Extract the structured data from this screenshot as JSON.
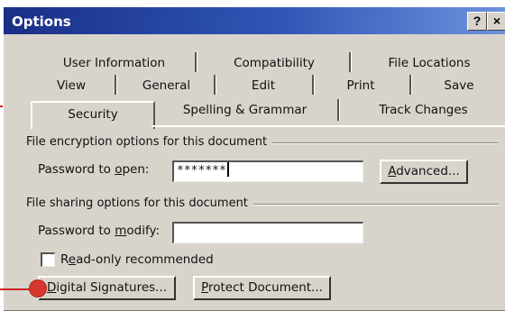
{
  "window": {
    "title": "Options",
    "help_label": "?",
    "close_label": "×"
  },
  "tabs": {
    "row1": [
      "User Information",
      "Compatibility",
      "File Locations"
    ],
    "row2": [
      "View",
      "General",
      "Edit",
      "Print",
      "Save"
    ],
    "row3": [
      "Security",
      "Spelling & Grammar",
      "Track Changes"
    ],
    "active": "Security"
  },
  "encryption": {
    "group_label": "File encryption options for this document",
    "password_label_pre": "Password to ",
    "password_label_key": "o",
    "password_label_post": "pen:",
    "password_value": "*******",
    "advanced_pre": "",
    "advanced_key": "A",
    "advanced_post": "dvanced..."
  },
  "sharing": {
    "group_label": "File sharing options for this document",
    "modify_label_pre": "Password to ",
    "modify_label_key": "m",
    "modify_label_post": "odify:",
    "modify_value": "",
    "readonly_label_pre": "R",
    "readonly_label_key": "e",
    "readonly_label_post": "ad-only recommended",
    "readonly_checked": false
  },
  "buttons": {
    "digital_pre": "",
    "digital_key": "D",
    "digital_post": "igital Signatures...",
    "protect_pre": "",
    "protect_key": "P",
    "protect_post": "rotect Document..."
  },
  "colors": {
    "callout": "#d8372d",
    "titlebar": "#1a2f86"
  }
}
